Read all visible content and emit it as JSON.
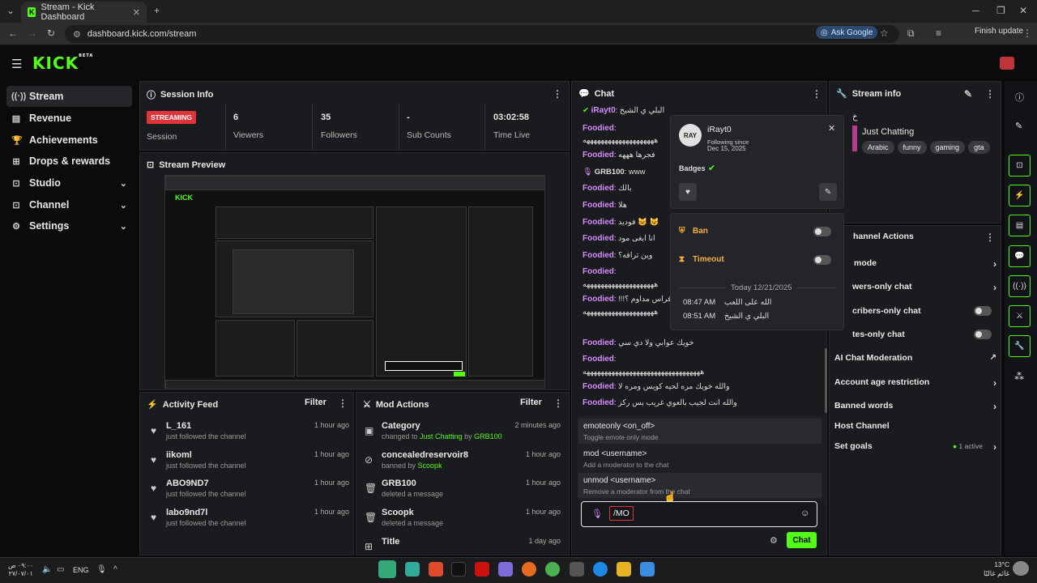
{
  "browser": {
    "tab_title": "Stream - Kick Dashboard",
    "url": "dashboard.kick.com/stream",
    "ask_google": "Ask Google",
    "finish_update": "Finish update"
  },
  "brand": {
    "logo": "KICK",
    "logo_sup": "BETA",
    "accent": "#53fc18"
  },
  "sidebar": {
    "items": [
      {
        "label": "Stream",
        "icon": "broadcast-icon"
      },
      {
        "label": "Revenue",
        "icon": "revenue-icon"
      },
      {
        "label": "Achievements",
        "icon": "trophy-icon"
      },
      {
        "label": "Drops & rewards",
        "icon": "gift-icon"
      },
      {
        "label": "Studio",
        "icon": "studio-icon"
      },
      {
        "label": "Channel",
        "icon": "channel-icon"
      },
      {
        "label": "Settings",
        "icon": "gear-icon"
      }
    ]
  },
  "session": {
    "title": "Session Info",
    "status_badge": "STREAMING",
    "status_label": "Session",
    "stats": [
      {
        "value": "6",
        "label": "Viewers"
      },
      {
        "value": "35",
        "label": "Followers"
      },
      {
        "value": "-",
        "label": "Sub Counts"
      },
      {
        "value": "03:02:58",
        "label": "Time Live"
      }
    ]
  },
  "preview": {
    "title": "Stream Preview"
  },
  "activity": {
    "title": "Activity Feed",
    "filter": "Filter",
    "items": [
      {
        "name": "L_161",
        "sub": "just followed the channel",
        "time": "1 hour ago"
      },
      {
        "name": "iikoml",
        "sub": "just followed the channel",
        "time": "1 hour ago"
      },
      {
        "name": "ABO9ND7",
        "sub": "just followed the channel",
        "time": "1 hour ago"
      },
      {
        "name": "labo9nd7l",
        "sub": "just followed the channel",
        "time": "1 hour ago"
      }
    ]
  },
  "mod": {
    "title": "Mod Actions",
    "filter": "Filter",
    "items": [
      {
        "name": "Category",
        "sub_a": "changed to ",
        "sub_b": "Just Chatting",
        "sub_c": " by ",
        "sub_d": "GRB100",
        "time": "2 minutes ago"
      },
      {
        "name": "concealedreservoir8",
        "sub_a": "banned by ",
        "sub_b": "Scoopk",
        "sub_c": "",
        "sub_d": "",
        "time": "1 hour ago"
      },
      {
        "name": "GRB100",
        "sub_a": "deleted a message",
        "sub_b": "",
        "sub_c": "",
        "sub_d": "",
        "time": "1 hour ago"
      },
      {
        "name": "Scoopk",
        "sub_a": "deleted a message",
        "sub_b": "",
        "sub_c": "",
        "sub_d": "",
        "time": "1 hour ago"
      },
      {
        "name": "Title",
        "sub_a": "",
        "sub_b": "",
        "sub_c": "",
        "sub_d": "",
        "time": "1 day ago"
      }
    ]
  },
  "chat": {
    "title": "Chat",
    "messages": [
      {
        "user": "iRayt0",
        "text": "البلي ي الشيخ"
      },
      {
        "user": "Foodied",
        "text": ""
      },
      {
        "user": "",
        "text": "ههههههههههههههههههههه"
      },
      {
        "user": "Foodied",
        "text": "فجرها هههه"
      },
      {
        "user": "GRB100",
        "text": "www"
      },
      {
        "user": "Foodied",
        "text": "بالك"
      },
      {
        "user": "Foodied",
        "text": "هلا"
      },
      {
        "user": "Foodied",
        "text": "فوديد 😺 😺"
      },
      {
        "user": "Foodied",
        "text": "انا ابغى مود"
      },
      {
        "user": "Foodied",
        "text": "وين ترافه؟"
      },
      {
        "user": "Foodied",
        "text": ""
      },
      {
        "user": "",
        "text": "ههههههههههههههههههههه"
      },
      {
        "user": "Foodied",
        "text": "!!!افراس مداوم ؟"
      },
      {
        "user": "",
        "text": "ههههههههههههههههههههه"
      },
      {
        "user": "Foodied",
        "text": "خويك عوابي ولا دي سي"
      },
      {
        "user": "Foodied",
        "text": ""
      },
      {
        "user": "",
        "text": "هههههههههههههههههههههههههههههههههه"
      },
      {
        "user": "Foodied",
        "text": "والله خويك مره لحيه كويس ومره لا"
      },
      {
        "user": "Foodied",
        "text": "والله انت لجيب بالعوي غريب بس ركز"
      }
    ],
    "commands": [
      {
        "cmd": "emoteonly <on_off>",
        "desc": "Toggle emote only mode"
      },
      {
        "cmd": "mod <username>",
        "desc": "Add a moderator to the chat"
      },
      {
        "cmd": "unmod <username>",
        "desc": "Remove a moderator from the chat"
      }
    ],
    "input_value": "/MO",
    "send": "Chat"
  },
  "popup": {
    "username": "iRayt0",
    "avatar_text": "RAY",
    "following_since": "Following since",
    "following_date": "Dec 15, 2025",
    "badges": "Badges",
    "ban": "Ban",
    "timeout": "Timeout",
    "day": "Today 12/21/2025",
    "history": [
      {
        "time": "08:47 AM",
        "text": "الله على اللعب"
      },
      {
        "time": "08:51 AM",
        "text": "البلي ي الشيخ"
      }
    ]
  },
  "stream_info": {
    "title": "Stream info",
    "stream_title": "خ",
    "category": "Just Chatting",
    "tags": [
      "Arabic",
      "funny",
      "gaming",
      "gta"
    ]
  },
  "channel_actions": {
    "title": "hannel Actions",
    "rows": [
      {
        "label": "mode",
        "control": "chevron"
      },
      {
        "label": "wers-only chat",
        "control": "chevron"
      },
      {
        "label": "cribers-only chat",
        "control": "toggle"
      },
      {
        "label": "tes-only chat",
        "control": "toggle"
      },
      {
        "label": "AI Chat Moderation",
        "control": "link"
      },
      {
        "label": "Account age restriction",
        "control": "chevron"
      },
      {
        "label": "Banned words",
        "control": "chevron"
      },
      {
        "label": "Host Channel",
        "control": "none"
      },
      {
        "label": "Set goals",
        "control": "chevron"
      }
    ],
    "goals_active": "1 active"
  },
  "taskbar": {
    "time": "٠٩:٠٠ ص",
    "date": "٢٧/٠٧/٠١",
    "lang": "ENG",
    "weather_temp": "13°C",
    "weather_text": "غائم غالبًا"
  }
}
